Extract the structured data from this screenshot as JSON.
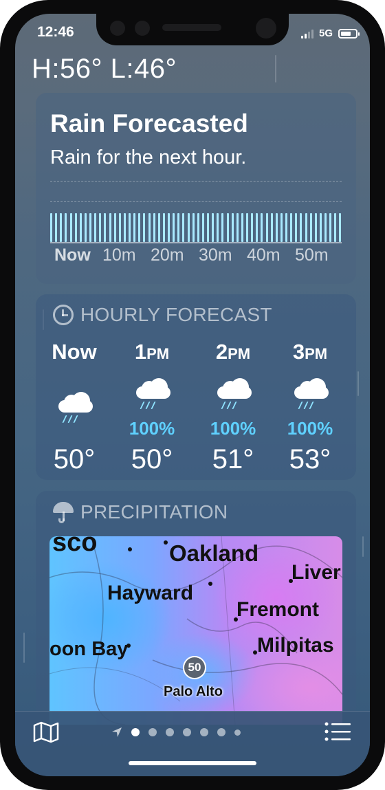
{
  "status": {
    "time": "12:46",
    "network": "5G"
  },
  "header": {
    "high_low": "H:56°  L:46°"
  },
  "rain_card": {
    "title": "Rain Forecasted",
    "subtitle": "Rain for the next hour.",
    "ticks": [
      "Now",
      "10m",
      "20m",
      "30m",
      "40m",
      "50m"
    ]
  },
  "hourly": {
    "title": "HOURLY FORECAST",
    "icon": "clock-icon",
    "items": [
      {
        "hour": "Now",
        "suffix": "",
        "pct": "",
        "temp": "50°"
      },
      {
        "hour": "1",
        "suffix": "PM",
        "pct": "100%",
        "temp": "50°"
      },
      {
        "hour": "2",
        "suffix": "PM",
        "pct": "100%",
        "temp": "51°"
      },
      {
        "hour": "3",
        "suffix": "PM",
        "pct": "100%",
        "temp": "53°"
      }
    ]
  },
  "precip": {
    "title": "PRECIPITATION",
    "icon": "umbrella-icon",
    "map": {
      "places": [
        "sco",
        "Oakland",
        "Liver",
        "Hayward",
        "Fremont",
        "oon Bay",
        "Milpitas"
      ],
      "route_badge": "50",
      "bottom_label": "Palo Alto"
    }
  },
  "bottom_bar": {
    "pages": 8,
    "active_page": 1
  },
  "colors": {
    "accent_rain": "#a9e9ff",
    "pct_blue": "#5fd1ff"
  }
}
